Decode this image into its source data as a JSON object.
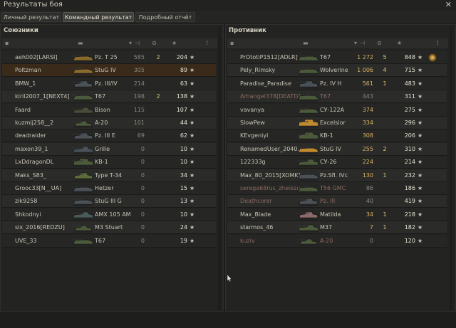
{
  "window": {
    "title": "Результаты боя"
  },
  "tabs": [
    {
      "label": "Личный результат",
      "active": false
    },
    {
      "label": "Командный результат",
      "active": true
    },
    {
      "label": "Подробный отчёт",
      "active": false
    }
  ],
  "allies": {
    "title": "Союзники",
    "rows": [
      {
        "player": "aeh002[LARSI]",
        "tank": "Pz. T 25",
        "xp": "585",
        "kills": "2",
        "score": "204",
        "icon": "td",
        "color": "#8a6a2a"
      },
      {
        "player": "Poltzman",
        "tank": "StuG IV",
        "xp": "305",
        "kills": "",
        "score": "89",
        "icon": "td",
        "color": "#8a6a2a",
        "self": true
      },
      {
        "player": "BMW_1",
        "tank": "Pz. III/IV",
        "xp": "214",
        "kills": "",
        "score": "63",
        "icon": "medium",
        "color": "#4a5258"
      },
      {
        "player": "kiril2007_1[NEXT4]",
        "tank": "T67",
        "xp": "198",
        "kills": "2",
        "score": "138",
        "icon": "td",
        "color": "#4a5a3a"
      },
      {
        "player": "Faard",
        "tank": "Bison",
        "xp": "115",
        "kills": "",
        "score": "107",
        "icon": "spg",
        "color": "#4a4a3a"
      },
      {
        "player": "kuzmij258__2",
        "tank": "A-20",
        "xp": "101",
        "kills": "",
        "score": "44",
        "icon": "light",
        "color": "#4a5a3a"
      },
      {
        "player": "deadraider",
        "tank": "Pz. III E",
        "xp": "69",
        "kills": "",
        "score": "62",
        "icon": "medium",
        "color": "#4a5258"
      },
      {
        "player": "maxon39_1",
        "tank": "Grille",
        "xp": "0",
        "kills": "",
        "score": "10",
        "icon": "spg",
        "color": "#4a5258"
      },
      {
        "player": "LxDdragonDL",
        "tank": "KB-1",
        "xp": "0",
        "kills": "",
        "score": "10",
        "icon": "heavy",
        "color": "#4a5a3a"
      },
      {
        "player": "Maks_S83_",
        "tank": "Type T-34",
        "xp": "0",
        "kills": "",
        "score": "34",
        "icon": "medium",
        "color": "#5a6a3a"
      },
      {
        "player": "Grooc33[N__UA]",
        "tank": "Hetzer",
        "xp": "0",
        "kills": "",
        "score": "15",
        "icon": "td",
        "color": "#4a5258"
      },
      {
        "player": "zik9258",
        "tank": "StuG III G",
        "xp": "0",
        "kills": "",
        "score": "13",
        "icon": "td",
        "color": "#4a5258"
      },
      {
        "player": "Shkodnyi",
        "tank": "AMX 105 AM",
        "xp": "0",
        "kills": "",
        "score": "10",
        "icon": "spg",
        "color": "#4a5a5a"
      },
      {
        "player": "six_2016[REDZU]",
        "tank": "M3 Stuart",
        "xp": "0",
        "kills": "",
        "score": "24",
        "icon": "light",
        "color": "#4a5a3a"
      },
      {
        "player": "UVE_33",
        "tank": "T67",
        "xp": "0",
        "kills": "",
        "score": "19",
        "icon": "td",
        "color": "#4a5a3a"
      }
    ]
  },
  "enemies": {
    "title": "Противник",
    "rows": [
      {
        "player": "PrOtotiP1512[ADLR]",
        "tank": "T67",
        "xp": "1 272",
        "kills": "5",
        "score": "848",
        "icon": "td",
        "color": "#4a5a3a",
        "medal": true,
        "bright": true
      },
      {
        "player": "Pely_Rimsky",
        "tank": "Wolverine",
        "xp": "1 006",
        "kills": "4",
        "score": "715",
        "icon": "td",
        "color": "#4a5a3a",
        "bright": true
      },
      {
        "player": "Paradise_Paradise",
        "tank": "Pz. IV H",
        "xp": "561",
        "kills": "1",
        "score": "483",
        "icon": "medium",
        "color": "#4a5258",
        "bright": true
      },
      {
        "player": "Arhangel378[DEATD]",
        "tank": "T67",
        "xp": "443",
        "kills": "",
        "score": "311",
        "icon": "td",
        "color": "#4a5a3a",
        "dead": true
      },
      {
        "player": "vavanya",
        "tank": "СУ-122А",
        "xp": "374",
        "kills": "",
        "score": "275",
        "icon": "td",
        "color": "#4a5a3a",
        "bright": true
      },
      {
        "player": "SlowPew",
        "tank": "Excelsior",
        "xp": "334",
        "kills": "",
        "score": "296",
        "icon": "heavy",
        "color": "#c08a30",
        "bright": true
      },
      {
        "player": "KEvgeniyl",
        "tank": "KB-1",
        "xp": "308",
        "kills": "",
        "score": "206",
        "icon": "heavy",
        "color": "#4a5a3a",
        "bright": true
      },
      {
        "player": "RenamedUser_2040...",
        "tank": "StuG IV",
        "xp": "255",
        "kills": "2",
        "score": "310",
        "icon": "td",
        "color": "#c08a30",
        "bright": true
      },
      {
        "player": "122333g",
        "tank": "СУ-26",
        "xp": "224",
        "kills": "",
        "score": "214",
        "icon": "spg",
        "color": "#4a5a3a",
        "bright": true
      },
      {
        "player": "Max_80_2015[XOMK]",
        "tank": "Pz.Sfl. IVc",
        "xp": "130",
        "kills": "1",
        "score": "232",
        "icon": "td",
        "color": "#4a5258",
        "bright": true
      },
      {
        "player": "serega68rus_zhelezm...",
        "tank": "T56 GMC",
        "xp": "86",
        "kills": "",
        "score": "186",
        "icon": "td",
        "color": "#4a5a3a",
        "dead": true
      },
      {
        "player": "Deathcorer",
        "tank": "Pz. III",
        "xp": "40",
        "kills": "",
        "score": "419",
        "icon": "medium",
        "color": "#4a5258",
        "dead": true
      },
      {
        "player": "Max_Blade",
        "tank": "Matilda",
        "xp": "34",
        "kills": "1",
        "score": "218",
        "icon": "medium",
        "color": "#8a6a6a",
        "bright": true
      },
      {
        "player": "starmos_46",
        "tank": "M37",
        "xp": "7",
        "kills": "1",
        "score": "182",
        "icon": "spg",
        "color": "#4a5a3a",
        "bright": true
      },
      {
        "player": "kuziv",
        "tank": "A-20",
        "xp": "0",
        "kills": "",
        "score": "120",
        "icon": "light",
        "color": "#4a5a3a",
        "dead": true
      }
    ]
  }
}
